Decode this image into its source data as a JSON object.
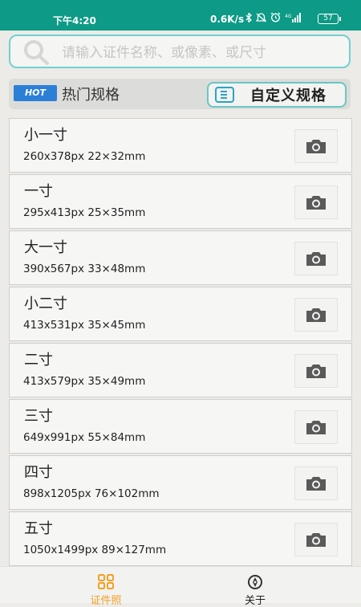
{
  "status_bar": {
    "time": "下午4:20",
    "network_speed": "0.6K/s",
    "battery": "57"
  },
  "search": {
    "placeholder": "请输入证件名称、或像素、或尺寸",
    "value": ""
  },
  "hot": {
    "badge": "HOT",
    "title": "热门规格",
    "custom_label": "自定义规格"
  },
  "sizes": [
    {
      "name": "小一寸",
      "dims": "260x378px  22×32mm"
    },
    {
      "name": "一寸",
      "dims": "295x413px  25×35mm"
    },
    {
      "name": "大一寸",
      "dims": "390x567px  33×48mm"
    },
    {
      "name": "小二寸",
      "dims": "413x531px  35×45mm"
    },
    {
      "name": "二寸",
      "dims": "413x579px  35×49mm"
    },
    {
      "name": "三寸",
      "dims": "649x991px  55×84mm"
    },
    {
      "name": "四寸",
      "dims": "898x1205px  76×102mm"
    },
    {
      "name": "五寸",
      "dims": "1050x1499px  89×127mm"
    }
  ],
  "tabs": [
    {
      "label": "证件照",
      "icon": "grid-icon",
      "active": true
    },
    {
      "label": "关于",
      "icon": "compass-icon",
      "active": false
    }
  ],
  "colors": {
    "status_bar": "#0d9a86",
    "accent_teal": "#67c8c4",
    "hot_badge": "#2c7fd6",
    "tab_active": "#f3a020"
  }
}
